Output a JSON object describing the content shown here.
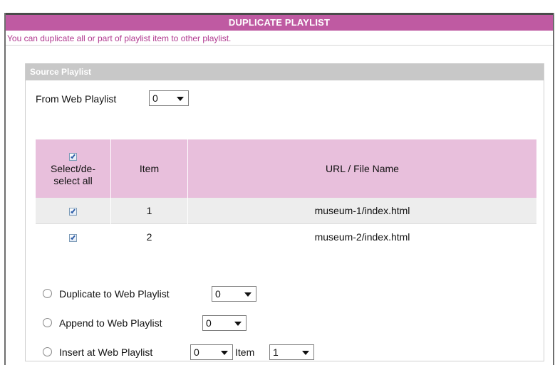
{
  "header": {
    "title": "DUPLICATE PLAYLIST"
  },
  "description": "You can duplicate all or part of playlist item to other playlist.",
  "source": {
    "title": "Source Playlist",
    "from_label": "From Web Playlist",
    "from_value": "0"
  },
  "table": {
    "headers": {
      "select": "Select/de-select all",
      "item": "Item",
      "url": "URL / File Name"
    },
    "rows": [
      {
        "item": "1",
        "url": "museum-1/index.html"
      },
      {
        "item": "2",
        "url": "museum-2/index.html"
      }
    ]
  },
  "options": {
    "duplicate": {
      "label": "Duplicate to Web Playlist",
      "value": "0"
    },
    "append": {
      "label": "Append to Web Playlist",
      "value": "0"
    },
    "insert": {
      "label": "Insert at Web Playlist",
      "value": "0",
      "item_label": "Item",
      "item_value": "1"
    }
  }
}
